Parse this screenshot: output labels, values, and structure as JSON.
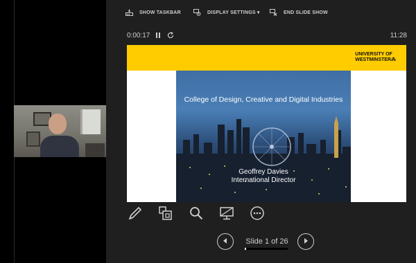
{
  "toolbar": {
    "show_taskbar": "SHOW TASKBAR",
    "display_settings": "DISPLAY SETTINGS ▾",
    "end_slide_show": "END SLIDE SHOW"
  },
  "timer": {
    "elapsed": "0:00:17",
    "clock": "11:28"
  },
  "slide": {
    "logo_line1": "UNIVERSITY OF",
    "logo_line2": "WESTMINSTER",
    "logo_mark": "⁂",
    "title": "College of Design, Creative and Digital Industries",
    "presenter_name": "Geoffrey Davies",
    "presenter_role": "International Director"
  },
  "navigation": {
    "counter": "Slide 1 of 26",
    "progress": 0.03846
  },
  "tools": [
    "pen-icon",
    "slides-grid-icon",
    "magnifier-icon",
    "pointer-screen-icon",
    "more-icon"
  ],
  "colors": {
    "accent_yellow": "#ffcc00",
    "background": "#1f1f1f"
  }
}
